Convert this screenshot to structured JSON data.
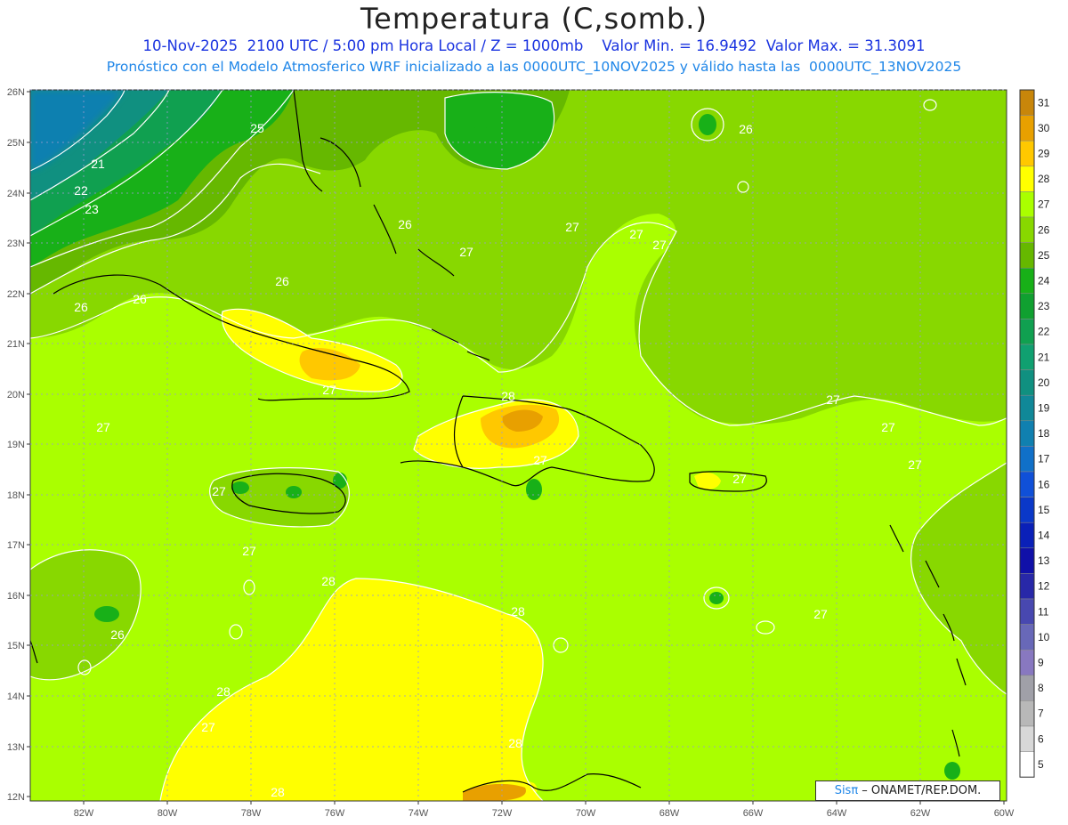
{
  "title": "Temperatura (C,somb.)",
  "subtitle1": "10-Nov-2025  2100 UTC / 5:00 pm Hora Local / Z = 1000mb    Valor Min. = 16.9492  Valor Max. = 31.3091",
  "subtitle2": "Pronóstico con el Modelo Atmosferico WRF inicializado a las 0000UTC_10NOV2025 y válido hasta las  0000UTC_13NOV2025",
  "credit": {
    "brand": "Sisπ",
    "text": " – ONAMET/REP.DOM."
  },
  "lat_labels": [
    "26N",
    "25N",
    "24N",
    "23N",
    "22N",
    "21N",
    "20N",
    "19N",
    "18N",
    "17N",
    "16N",
    "15N",
    "14N",
    "13N",
    "12N"
  ],
  "lon_labels": [
    "82W",
    "80W",
    "78W",
    "76W",
    "74W",
    "72W",
    "70W",
    "68W",
    "66W",
    "64W",
    "62W",
    "60W"
  ],
  "colorbar": {
    "levels": [
      31,
      30,
      29,
      28,
      27,
      26,
      25,
      24,
      23,
      22,
      21,
      20,
      19,
      18,
      17,
      16,
      15,
      14,
      13,
      12,
      11,
      10,
      9,
      8,
      7,
      6,
      5
    ],
    "colors": [
      "#c8860a",
      "#e8a000",
      "#ffc800",
      "#ffff00",
      "#aaff00",
      "#88d800",
      "#66b800",
      "#18b018",
      "#10a030",
      "#10a050",
      "#10a070",
      "#109080",
      "#108898",
      "#1080b0",
      "#1070c8",
      "#1050d8",
      "#0a38c8",
      "#0a20b8",
      "#1010a8",
      "#2828a8",
      "#4848b0",
      "#6868b8",
      "#8878c0",
      "#a0a0a8",
      "#b8b8b8",
      "#d8d8d8",
      "#ffffff"
    ]
  },
  "contour_labels": [
    {
      "text": "25"
    },
    {
      "text": "21"
    },
    {
      "text": "22"
    },
    {
      "text": "23"
    },
    {
      "text": "26"
    },
    {
      "text": "26"
    },
    {
      "text": "26"
    },
    {
      "text": "26"
    },
    {
      "text": "27"
    },
    {
      "text": "27"
    },
    {
      "text": "27"
    },
    {
      "text": "27"
    },
    {
      "text": "26"
    },
    {
      "text": "27"
    },
    {
      "text": "27"
    },
    {
      "text": "28"
    },
    {
      "text": "27"
    },
    {
      "text": "27"
    },
    {
      "text": "27"
    },
    {
      "text": "27"
    },
    {
      "text": "27"
    },
    {
      "text": "27"
    },
    {
      "text": "28"
    },
    {
      "text": "28"
    },
    {
      "text": "26"
    },
    {
      "text": "27"
    },
    {
      "text": "28"
    },
    {
      "text": "27"
    },
    {
      "text": "28"
    },
    {
      "text": "28"
    },
    {
      "text": "27"
    }
  ]
}
